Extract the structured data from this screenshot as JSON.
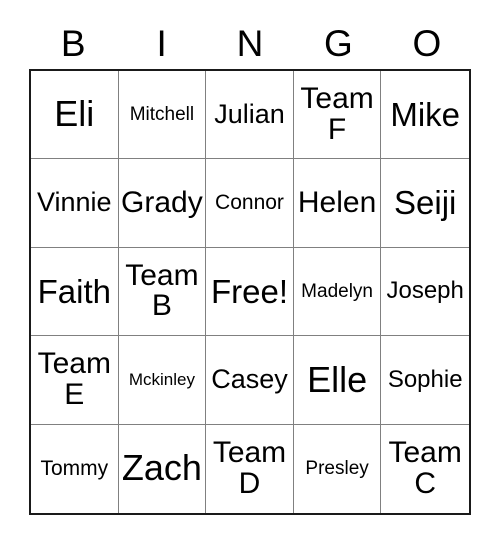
{
  "card": {
    "type": "bingo-card",
    "columns": [
      "B",
      "I",
      "N",
      "G",
      "O"
    ],
    "free_space": "Free!",
    "background_color": "#ffffff",
    "text_color": "#000000",
    "outer_border_color": "#1a1a1a",
    "inner_border_color": "#808080"
  },
  "header": {
    "letters": [
      {
        "label": "B"
      },
      {
        "label": "I"
      },
      {
        "label": "N"
      },
      {
        "label": "G"
      },
      {
        "label": "O"
      }
    ]
  },
  "grid": {
    "rows": 5,
    "cols": 5,
    "cells": [
      {
        "text": "Eli",
        "size": "huge"
      },
      {
        "text": "Mitchell",
        "size": "sm"
      },
      {
        "text": "Julian",
        "size": "lg"
      },
      {
        "text": "Team\nF",
        "size": "xl"
      },
      {
        "text": "Mike",
        "size": "xxl"
      },
      {
        "text": "Vinnie",
        "size": "lg"
      },
      {
        "text": "Grady",
        "size": "xl"
      },
      {
        "text": "Connor",
        "size": "smd"
      },
      {
        "text": "Helen",
        "size": "xl"
      },
      {
        "text": "Seiji",
        "size": "xxl"
      },
      {
        "text": "Faith",
        "size": "xxl"
      },
      {
        "text": "Team\nB",
        "size": "xl"
      },
      {
        "text": "Free!",
        "size": "xxl"
      },
      {
        "text": "Madelyn",
        "size": "sm"
      },
      {
        "text": "Joseph",
        "size": "md"
      },
      {
        "text": "Team\nE",
        "size": "xl"
      },
      {
        "text": "Mckinley",
        "size": "xs"
      },
      {
        "text": "Casey",
        "size": "lg"
      },
      {
        "text": "Elle",
        "size": "huge"
      },
      {
        "text": "Sophie",
        "size": "md"
      },
      {
        "text": "Tommy",
        "size": "smd"
      },
      {
        "text": "Zach",
        "size": "huge"
      },
      {
        "text": "Team\nD",
        "size": "xl"
      },
      {
        "text": "Presley",
        "size": "sm"
      },
      {
        "text": "Team\nC",
        "size": "xl"
      }
    ]
  }
}
